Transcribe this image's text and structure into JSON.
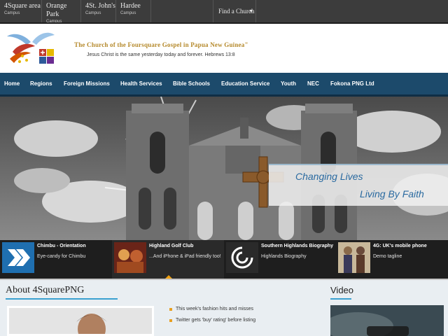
{
  "campuses": [
    {
      "name": "4Square area",
      "sub": "Campus"
    },
    {
      "name": "Orange Park",
      "sub": "Campus"
    },
    {
      "name": "4St. John's",
      "sub": "Campus"
    },
    {
      "name": "Hardee",
      "sub": "Campus"
    }
  ],
  "find_church": "Find a Church",
  "header": {
    "org_name": "The Church of the Foursquare Gospel in Papua New Guinea\"",
    "tagline": "Jesus Christ is the same yesterday today and forever. Hebrews 13:8"
  },
  "nav": [
    "Home",
    "Regions",
    "Foreign Missions",
    "Health Services",
    "Bible Schools",
    "Education Service",
    "Youth",
    "NEC",
    "Fokona PNG Ltd"
  ],
  "hero": {
    "line1": "Changing Lives",
    "line2": "Living By Faith"
  },
  "thumbs": [
    {
      "title": "Chimbu - Orientation",
      "desc": "Eye-candy for Chimbu"
    },
    {
      "title": "Highland Golf Club",
      "desc": "...And iPhone & iPad friendly too!"
    },
    {
      "title": "Southern Highlands Biography",
      "desc": "Highlands Biography"
    },
    {
      "title": "4G: UK's mobile phone",
      "desc": "Demo tagline"
    }
  ],
  "about": {
    "title": "About 4SquarePNG",
    "items": [
      "This week's fashion hits and misses",
      "Twitter gets 'buy' rating' before listing"
    ]
  },
  "video": {
    "title": "Video"
  },
  "colors": {
    "nav_bg": "#1c4a6b",
    "top_bar": "#3c3c3c",
    "gold": "#b5892b",
    "accent_blue": "#2a6aa0",
    "marker": "#f0a010"
  }
}
